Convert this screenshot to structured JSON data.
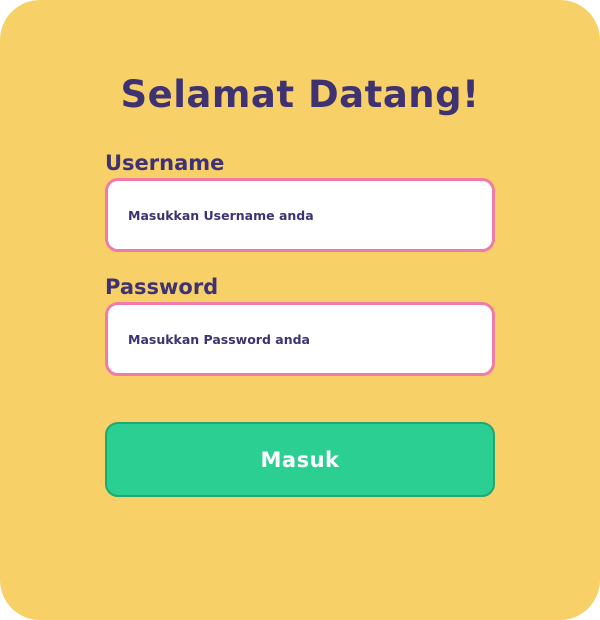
{
  "login": {
    "title": "Selamat Datang!",
    "username_label": "Username",
    "username_placeholder": "Masukkan Username anda",
    "password_label": "Password",
    "password_placeholder": "Masukkan Password anda",
    "submit_label": "Masuk"
  },
  "colors": {
    "card_background": "#F8D068",
    "text_primary": "#3F3272",
    "input_border": "#F07AA8",
    "button_background": "#2BCF91"
  }
}
